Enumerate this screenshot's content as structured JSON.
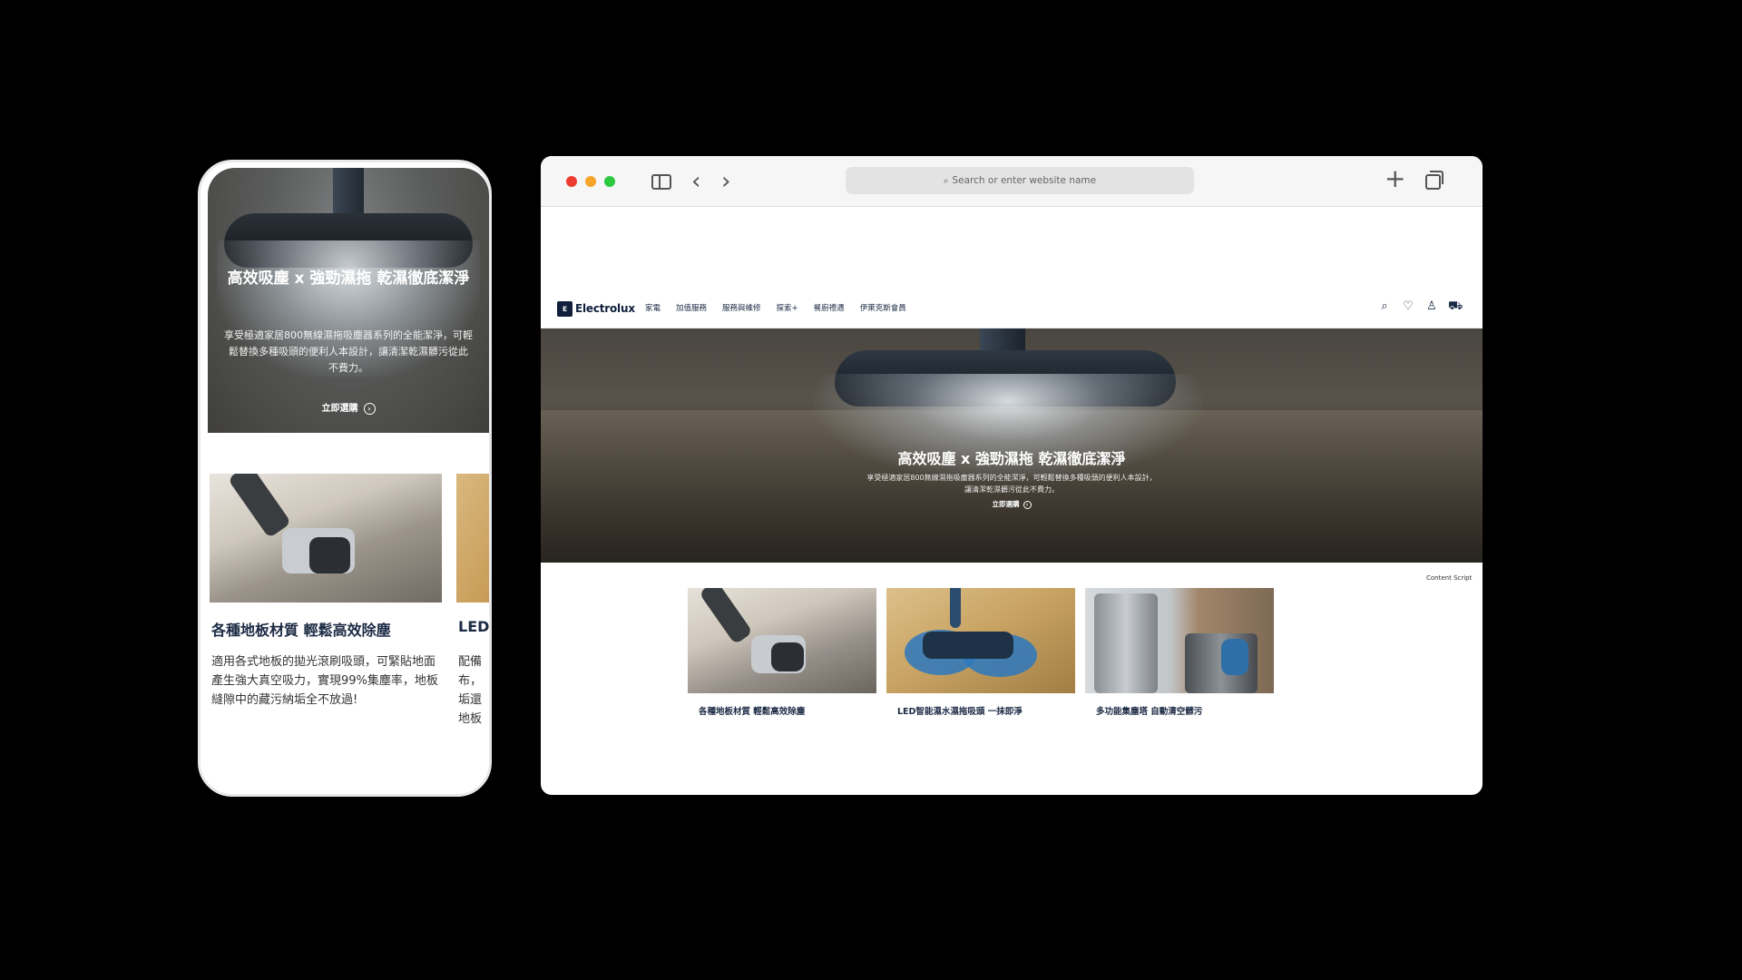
{
  "phone": {
    "hero": {
      "title": "高效吸塵 x 強勁濕拖 乾濕徹底潔淨",
      "description": "享受極適家居800無線濕拖吸塵器系列的全能潔淨，可輕鬆替換多種吸頭的便利人本設計，讓清潔乾濕髒污從此不費力。",
      "cta": "立即選購",
      "cta_icon": "arrow-circle-icon"
    },
    "card": {
      "title": "各種地板材質 輕鬆高效除塵",
      "description": "適用各式地板的拋光滾刷吸頭，可緊貼地面產生強大真空吸力，實現99%集塵率，地板縫隙中的藏污納垢全不放過!"
    },
    "card_partial": {
      "title": "LED",
      "description_lines": [
        "配備",
        "布，",
        "垢還",
        "地板"
      ]
    }
  },
  "browser": {
    "toolbar": {
      "address_placeholder": "Search or enter website name",
      "back_icon": "‹",
      "forward_icon": "›",
      "new_tab_icon": "+"
    },
    "site": {
      "logo_text": "Electrolux",
      "nav_items": [
        "家電",
        "加值服務",
        "服務與維修",
        "探索+",
        "餐廚禮遇",
        "伊萊克斯會員"
      ],
      "nav_icons": [
        "search-icon",
        "heart-icon",
        "user-icon",
        "cart-icon"
      ]
    },
    "hero": {
      "title": "高效吸塵 x 強勁濕拖 乾濕徹底潔淨",
      "description_line1": "享受極適家居800無線濕拖吸塵器系列的全能潔淨，可輕鬆替換多種吸頭的便利人本設計，",
      "description_line2": "讓清潔乾濕髒污從此不費力。",
      "cta": "立即選購"
    },
    "cards": [
      {
        "title": "各種地板材質 輕鬆高效除塵"
      },
      {
        "title": "LED智能濕水濕拖吸頭 一抹即淨"
      },
      {
        "title": "多功能集塵塔 自動清空髒污"
      }
    ],
    "content_script": "Content Script"
  },
  "colors": {
    "brand_navy": "#1b2a44",
    "traffic_red": "#ee3b30",
    "traffic_yellow": "#f5a42a",
    "traffic_green": "#2bc840"
  }
}
